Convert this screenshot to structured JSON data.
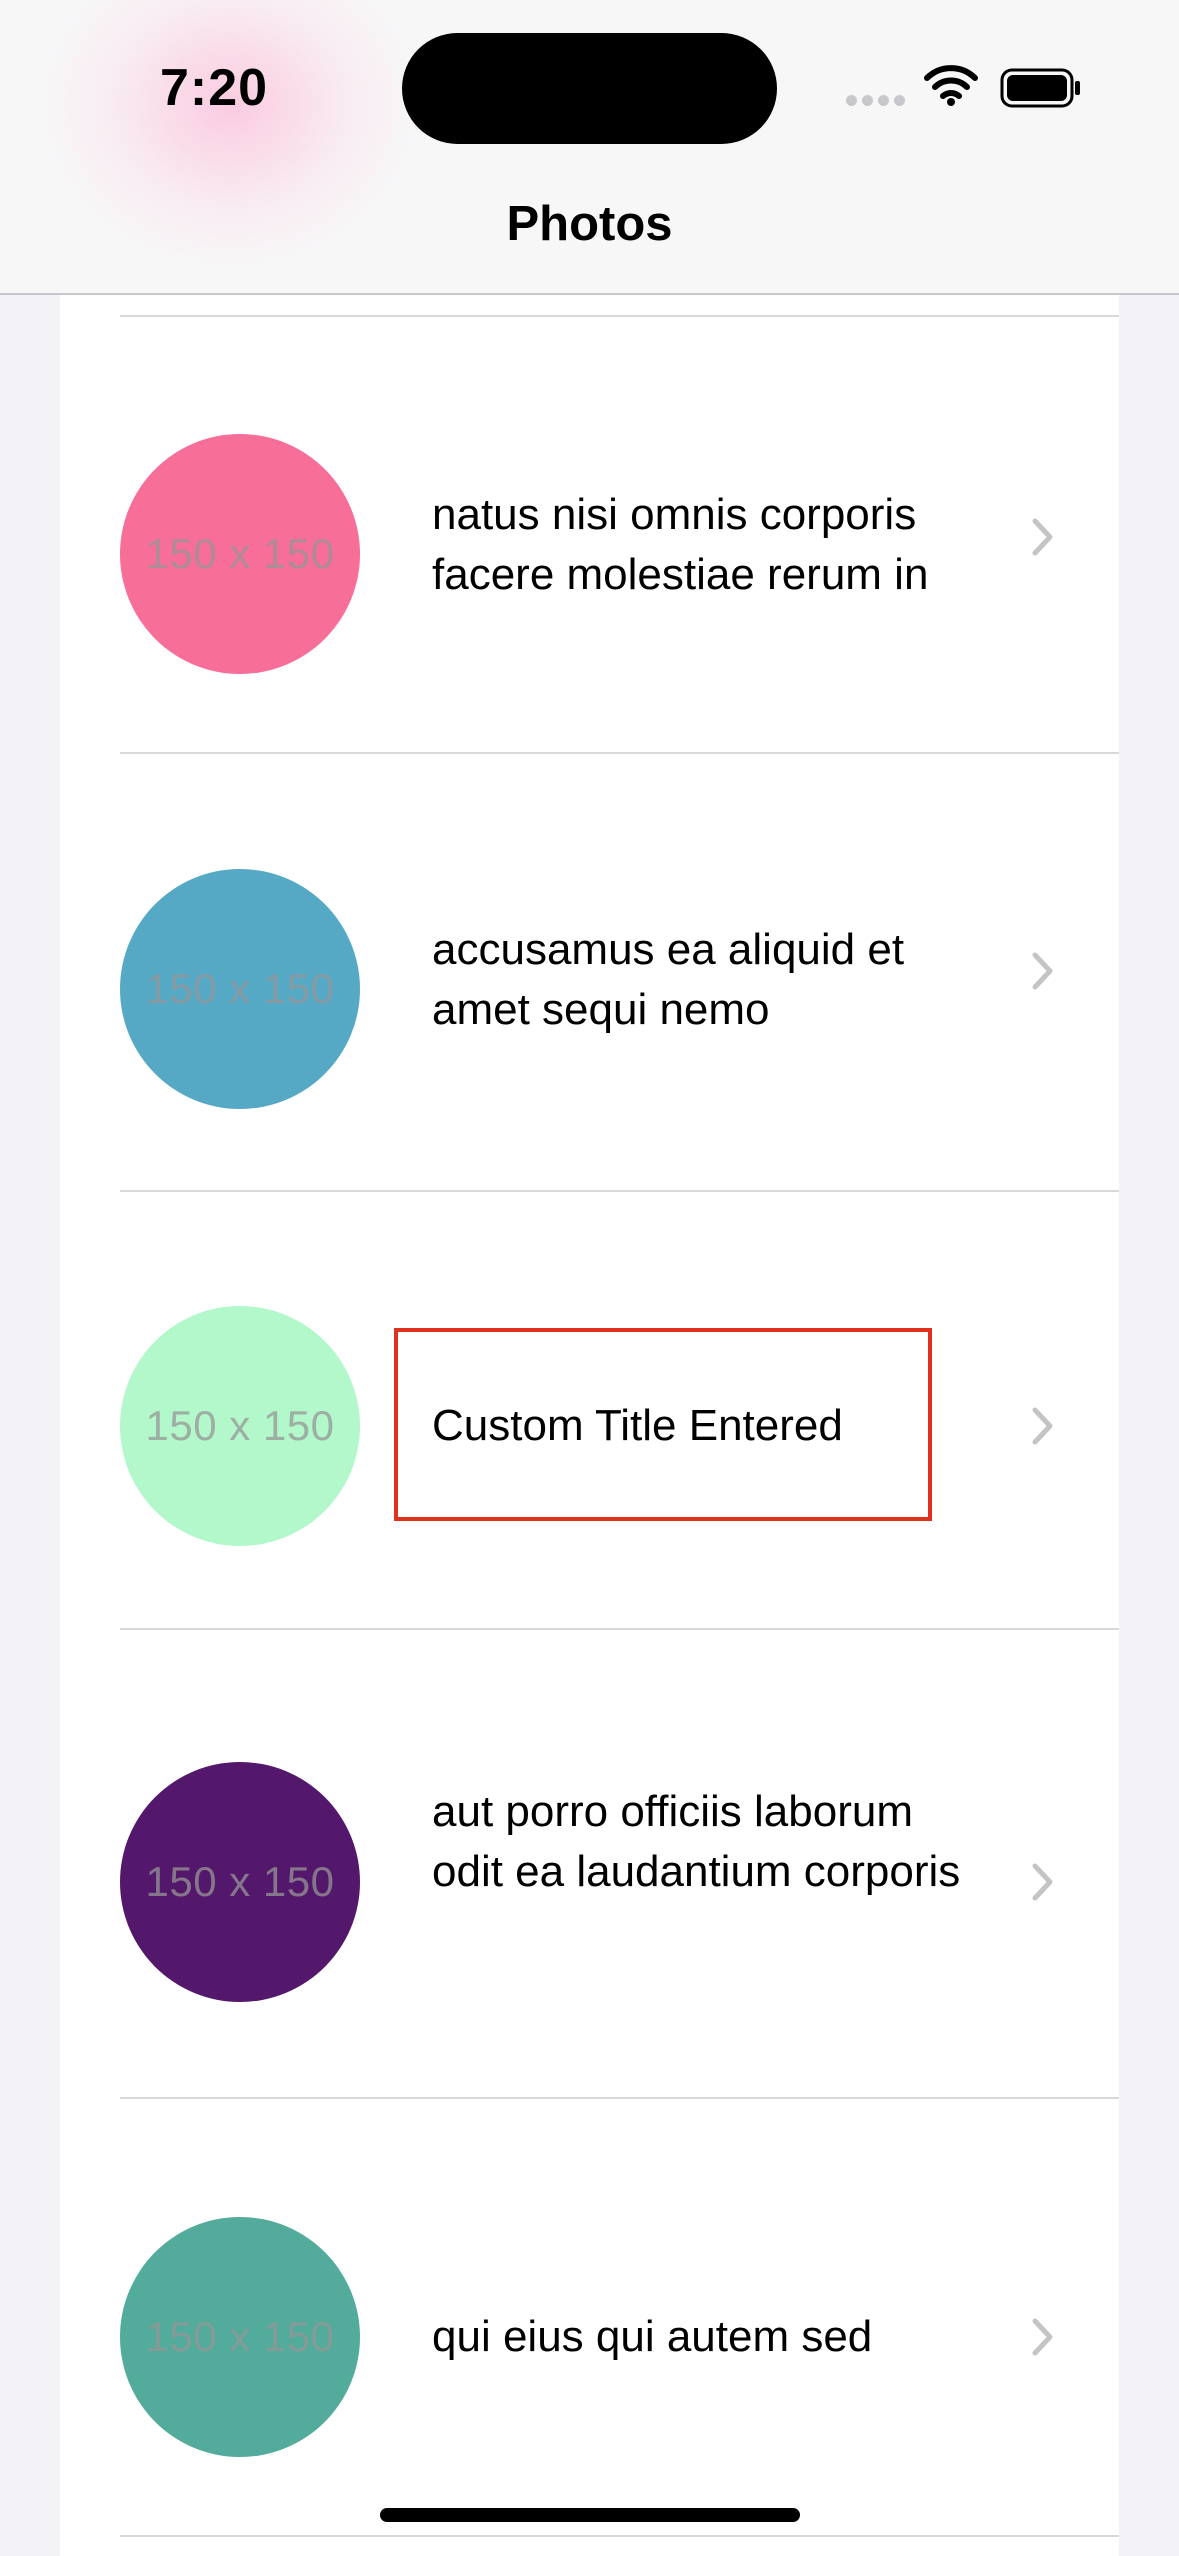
{
  "status_bar": {
    "time": "7:20",
    "wifi_icon": "wifi-icon",
    "battery_icon": "battery-full-icon"
  },
  "nav": {
    "title": "Photos"
  },
  "rows": [
    {
      "title": "natus nisi omnis corporis facere molestiae rerum in",
      "thumb_label": "150 x 150",
      "thumb_color": "#f76e99"
    },
    {
      "title": "accusamus ea aliquid et amet sequi nemo",
      "thumb_label": "150 x 150",
      "thumb_color": "#56a9c5"
    },
    {
      "title": "Custom Title Entered",
      "thumb_label": "150 x 150",
      "thumb_color": "#b2f8cb",
      "highlighted": true
    },
    {
      "title": "aut porro officiis laborum odit ea laudantium corporis",
      "thumb_label": "150 x 150",
      "thumb_color": "#53186c"
    },
    {
      "title": "qui eius qui autem sed",
      "thumb_label": "150 x 150",
      "thumb_color": "#52ab9b"
    }
  ],
  "colors": {
    "highlight_border": "#e0311f",
    "chevron": "#c4c4c6",
    "separator": "#d8d8dc"
  }
}
